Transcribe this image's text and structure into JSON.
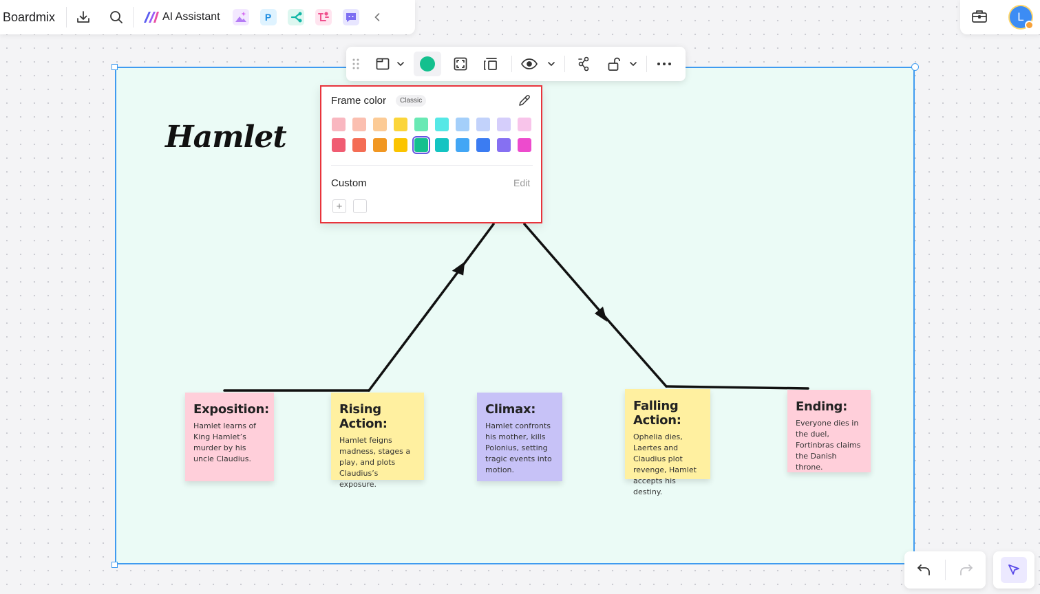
{
  "app": {
    "brand": "Boardmix",
    "ai_assistant_label": "AI Assistant"
  },
  "user": {
    "avatar_initial": "L"
  },
  "board": {
    "title": "Hamlet",
    "notes": [
      {
        "heading": "Exposition:",
        "body": "Hamlet learns of King Hamlet’s murder by his uncle Claudius.",
        "color": "#ffcfda"
      },
      {
        "heading": "Rising Action:",
        "body": "Hamlet feigns madness, stages a play, and plots Claudius’s exposure.",
        "color": "#fff0a0"
      },
      {
        "heading": "Climax:",
        "body": "Hamlet confronts his mother, kills Polonius, setting tragic events into motion.",
        "color": "#c7c2f7"
      },
      {
        "heading": "Falling Action:",
        "body": "Ophelia dies, Laertes and Claudius plot revenge, Hamlet accepts his destiny.",
        "color": "#fff0a0"
      },
      {
        "heading": "Ending:",
        "body": "Everyone dies in the duel, Fortinbras claims the Danish throne.",
        "color": "#ffcfda"
      }
    ],
    "frame_fill": "#ebfbf6"
  },
  "toolbar": {
    "current_color": "#14c08e"
  },
  "color_panel": {
    "title": "Frame color",
    "palette_label": "Classic",
    "light_row": [
      "#f9b7c0",
      "#fbbfb0",
      "#fccb96",
      "#fbd53a",
      "#69e9b4",
      "#56e8e6",
      "#a4cffa",
      "#c2d2fb",
      "#d5cefb",
      "#f8c4ea"
    ],
    "strong_row": [
      "#f05c72",
      "#f46d55",
      "#f19722",
      "#fbc400",
      "#14c08e",
      "#14c4c2",
      "#42a6f5",
      "#3b7cf2",
      "#8670f2",
      "#ed4bcd"
    ],
    "selected_color": "#14c08e",
    "custom_label": "Custom",
    "edit_label": "Edit"
  }
}
